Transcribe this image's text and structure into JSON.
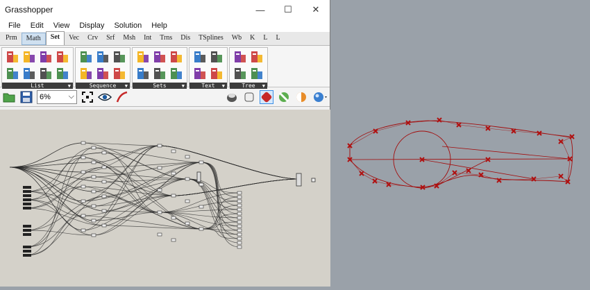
{
  "window": {
    "title": "Grasshopper",
    "minimize": "—",
    "maximize": "☐",
    "close": "✕"
  },
  "menu": [
    "File",
    "Edit",
    "View",
    "Display",
    "Solution",
    "Help"
  ],
  "tabs": [
    {
      "label": "Prm",
      "state": "normal"
    },
    {
      "label": "Math",
      "state": "hl"
    },
    {
      "label": "Set",
      "state": "active"
    },
    {
      "label": "Vec",
      "state": "normal"
    },
    {
      "label": "Crv",
      "state": "normal"
    },
    {
      "label": "Srf",
      "state": "normal"
    },
    {
      "label": "Msh",
      "state": "normal"
    },
    {
      "label": "Int",
      "state": "normal"
    },
    {
      "label": "Trns",
      "state": "normal"
    },
    {
      "label": "Dis",
      "state": "normal"
    },
    {
      "label": "TSplines",
      "state": "normal"
    },
    {
      "label": "Wb",
      "state": "normal"
    },
    {
      "label": "K",
      "state": "normal"
    },
    {
      "label": "L",
      "state": "normal"
    },
    {
      "label": "L",
      "state": "normal"
    }
  ],
  "ribbon": {
    "panels": [
      {
        "label": "List",
        "icons": [
          "list-item-icon",
          "sort-list-icon",
          "list-length-icon",
          "reverse-list-icon",
          "dispatch-icon",
          "shift-list-icon",
          "weave-icon",
          "sublist-icon"
        ]
      },
      {
        "label": "Sequence",
        "icons": [
          "cull-pattern-icon",
          "cull-index-icon",
          "series-icon",
          "range-icon",
          "fibonacci-icon",
          "random-icon"
        ]
      },
      {
        "label": "Sets",
        "icons": [
          "set-union-icon",
          "set-intersection-icon",
          "set-difference-icon",
          "set-exclusive-icon",
          "member-index-icon",
          "combinations-icon"
        ]
      },
      {
        "label": "Text",
        "icons": [
          "text-join-icon",
          "text-split-icon",
          "text-case-icon",
          "text-sort-icon"
        ]
      },
      {
        "label": "Tree",
        "icons": [
          "graft-tree-icon",
          "flatten-tree-icon",
          "simplify-tree-icon",
          "trim-tree-icon"
        ]
      }
    ],
    "expand_glyph": "▼"
  },
  "toolbar": {
    "zoom_value": "6%",
    "zoom_arrow": "⌵"
  },
  "colors": {
    "viewport_bg": "#9aa1a9",
    "canvas_bg": "#d4d1c9",
    "curve": "#a30c0c",
    "marker": "#b01010"
  }
}
